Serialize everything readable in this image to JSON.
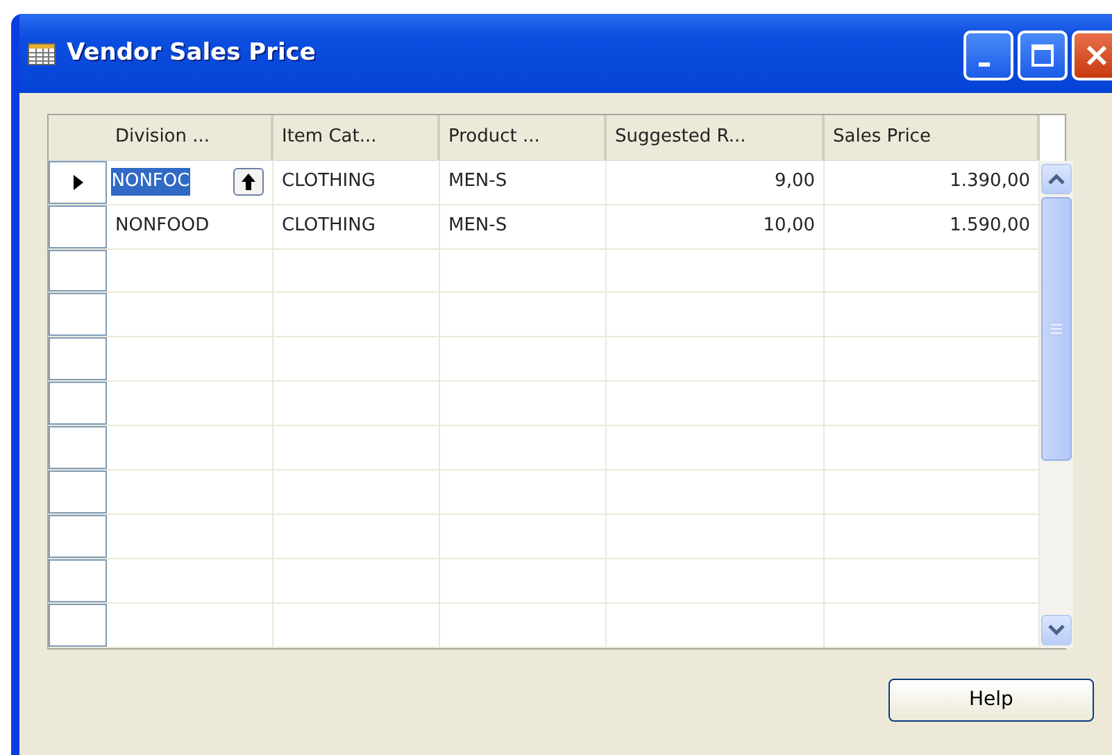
{
  "window": {
    "title": "Vendor Sales Price"
  },
  "table": {
    "columns": [
      {
        "label": "Division ...",
        "numeric": false
      },
      {
        "label": "Item Cat...",
        "numeric": false
      },
      {
        "label": "Product ...",
        "numeric": false
      },
      {
        "label": "Suggested R...",
        "numeric": true
      },
      {
        "label": "Sales Price",
        "numeric": true
      }
    ],
    "rows": [
      {
        "current": true,
        "cells": [
          {
            "text": "NONFOC",
            "selected": true
          },
          {
            "text": "CLOTHING",
            "selected": false
          },
          {
            "text": "MEN-S",
            "selected": false
          },
          {
            "text": "9,00",
            "selected": false
          },
          {
            "text": "1.390,00",
            "selected": false
          }
        ]
      },
      {
        "current": false,
        "cells": [
          {
            "text": "NONFOOD",
            "selected": false
          },
          {
            "text": "CLOTHING",
            "selected": false
          },
          {
            "text": "MEN-S",
            "selected": false
          },
          {
            "text": "10,00",
            "selected": false
          },
          {
            "text": "1.590,00",
            "selected": false
          }
        ]
      }
    ]
  },
  "buttons": [
    {
      "label": "Help"
    }
  ]
}
